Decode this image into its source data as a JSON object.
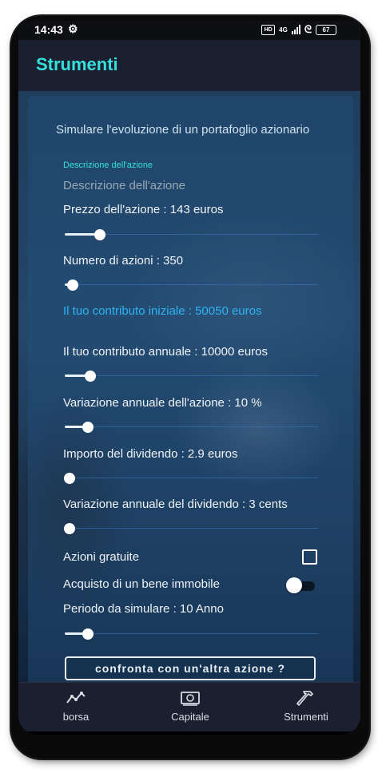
{
  "status_bar": {
    "time": "14:43",
    "network": "4G",
    "battery": "67"
  },
  "app_bar": {
    "title": "Strumenti"
  },
  "form": {
    "title": "Simulare l'evoluzione di un portafoglio azionario",
    "description_label": "Descrizione dell'azione",
    "description_placeholder": "Descrizione dell'azione",
    "price_label": "Prezzo dell'azione : 143 euros",
    "price_slider_value": 0.14,
    "shares_label": "Numero di azioni : 350",
    "shares_slider_value": 0.03,
    "initial_contribution": "Il tuo contributo iniziale : 50050 euros",
    "annual_contribution_label": "Il tuo contributo annuale : 10000 euros",
    "annual_contribution_slider_value": 0.1,
    "annual_change_label": "Variazione annuale dell'azione : 10 %",
    "annual_change_slider_value": 0.09,
    "dividend_label": "Importo del dividendo : 2.9 euros",
    "dividend_slider_value": 0.02,
    "dividend_change_label": "Variazione annuale del dividendo : 3 cents",
    "dividend_change_slider_value": 0.02,
    "free_shares_label": "Azioni gratuite",
    "free_shares_checked": false,
    "real_estate_label": "Acquisto di un bene immobile",
    "real_estate_on": false,
    "period_label": "Periodo da simulare : 10 Anno",
    "period_slider_value": 0.09,
    "compare_button": "confronta con un'altra azione ?"
  },
  "bottom_nav": [
    {
      "label": "borsa",
      "icon": "trending-line-icon"
    },
    {
      "label": "Capitale",
      "icon": "banknote-icon"
    },
    {
      "label": "Strumenti",
      "icon": "hammer-icon",
      "active": true
    }
  ],
  "colors": {
    "accent": "#35e0dc",
    "highlight": "#2fb3f3",
    "nav_bg": "#1b2030"
  }
}
